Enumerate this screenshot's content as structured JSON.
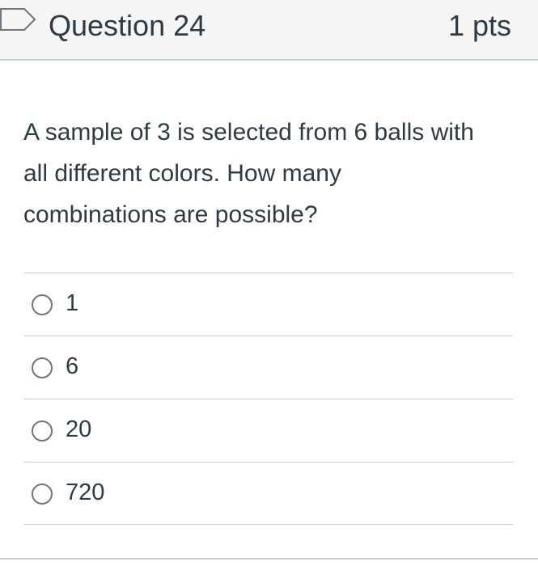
{
  "header": {
    "flag_icon": "flag-outline-icon",
    "title": "Question 24",
    "points": "1 pts"
  },
  "question": {
    "text": "A sample of 3 is selected from 6 balls with all different colors. How many combinations are possible?"
  },
  "answers": [
    {
      "label": "1",
      "selected": false
    },
    {
      "label": "6",
      "selected": false
    },
    {
      "label": "20",
      "selected": false
    },
    {
      "label": "720",
      "selected": false
    }
  ],
  "colors": {
    "header_background": "#f5f5f5",
    "divider": "#c7cdd1",
    "text": "#2d3b45",
    "radio_border": "#6b7780"
  }
}
